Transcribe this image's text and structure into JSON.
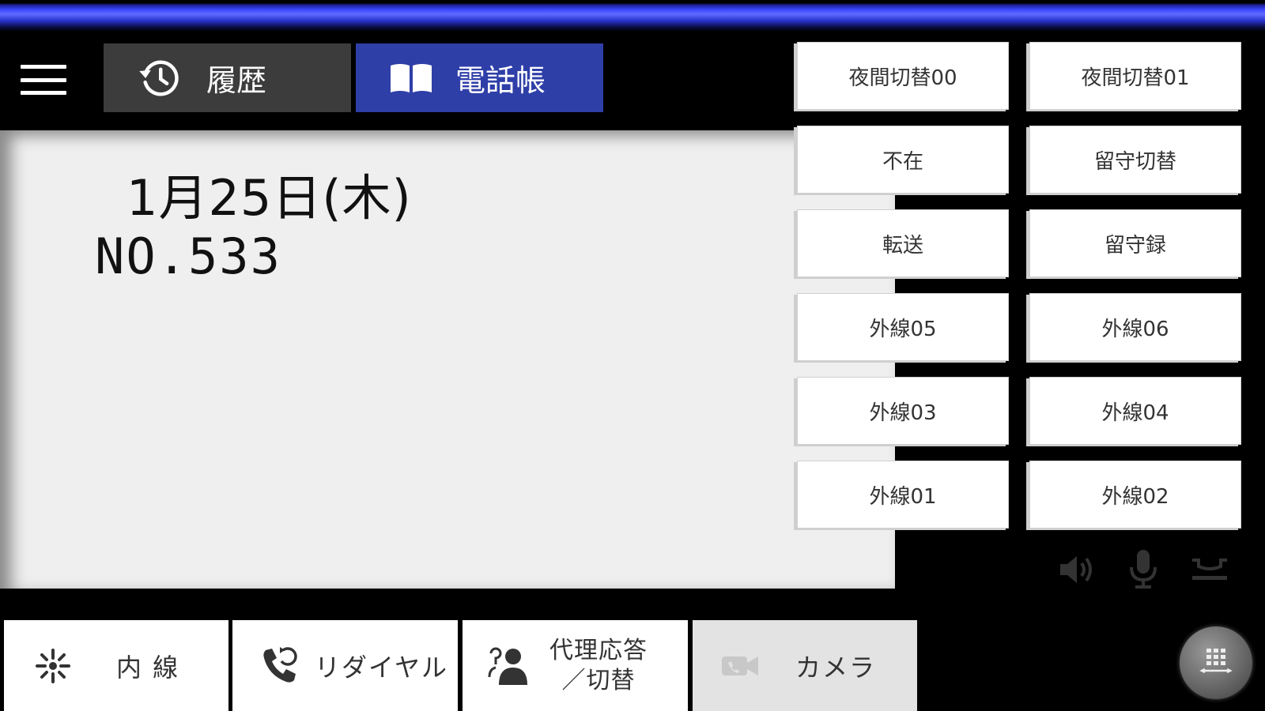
{
  "tabs": {
    "history_label": "履歴",
    "phonebook_label": "電話帳"
  },
  "display": {
    "date": "1月25日(木)",
    "number": "NO.533"
  },
  "keys": [
    [
      "夜間切替00",
      "夜間切替01"
    ],
    [
      "不在",
      "留守切替"
    ],
    [
      "転送",
      "留守録"
    ],
    [
      "外線05",
      "外線06"
    ],
    [
      "外線03",
      "外線04"
    ],
    [
      "外線01",
      "外線02"
    ]
  ],
  "bottom_buttons": {
    "extension": "内 線",
    "redial": "リダイヤル",
    "proxy_line1": "代理応答",
    "proxy_line2": "／切替",
    "camera": "カメラ"
  },
  "icons": {
    "menu": "hamburger-icon",
    "history": "history-icon",
    "phonebook": "book-icon",
    "speaker": "speaker-icon",
    "mic": "microphone-icon",
    "handset": "handset-icon",
    "extension": "extension-icon",
    "redial": "redial-icon",
    "proxy": "proxy-answer-icon",
    "camera": "camera-icon",
    "dialpad": "dialpad-icon"
  },
  "colors": {
    "accent_blue": "#2f3fa8",
    "tab_gray": "#3c3c3c",
    "panel_bg": "#efefef"
  }
}
